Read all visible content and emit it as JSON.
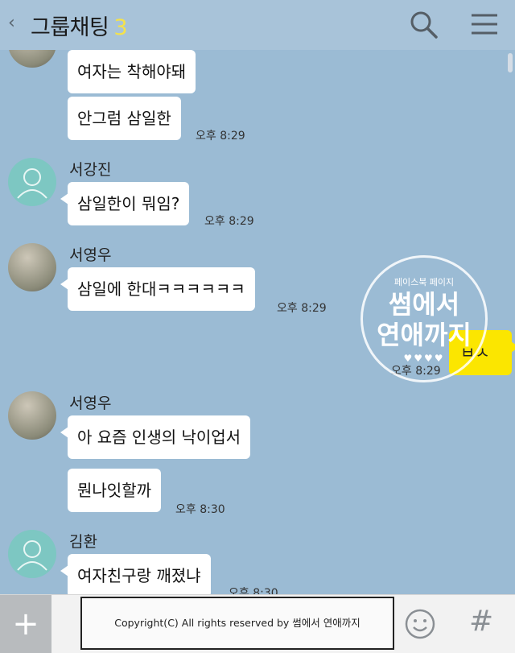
{
  "header": {
    "back_glyph": "‹",
    "title": "그룹채팅",
    "member_count": "3",
    "search_icon": "search-icon",
    "menu_icon": "menu-icon"
  },
  "messages": [
    {
      "sender": "",
      "text": "여자는 착해야돼",
      "time": ""
    },
    {
      "sender": "",
      "text": "안그럼 삼일한",
      "time": "오후 8:29"
    },
    {
      "sender": "서강진",
      "text": "삼일한이 뭐임?",
      "time": "오후 8:29"
    },
    {
      "sender": "서영우",
      "text": "삼일에 한대ㅋㅋㅋㅋㅋㅋ",
      "time": "오후 8:29"
    },
    {
      "sender": "서영우",
      "text": "아 요즘 인생의 낙이업서",
      "time": ""
    },
    {
      "sender": "",
      "text": "뭔나잇할까",
      "time": "오후 8:30"
    },
    {
      "sender": "김환",
      "text": "여자친구랑 깨졌냐",
      "time": "오후 8:30"
    }
  ],
  "my_message": {
    "text": "ㅂㅅ",
    "time": "오후 8:29"
  },
  "watermark": {
    "line1": "페이스북 페이지",
    "line2": "썸에서",
    "line3": "연애까지",
    "line4": "♥♥♥♥"
  },
  "bottom": {
    "plus_glyph": "+",
    "copyright": "Copyright(C) All rights reserved by 썸에서 연애까지",
    "emoji_icon": "emoji-icon",
    "hash_glyph": "#"
  },
  "colors": {
    "background": "#9bbbd4",
    "my_bubble": "#fbe600",
    "accent_count": "#f5e24a"
  }
}
